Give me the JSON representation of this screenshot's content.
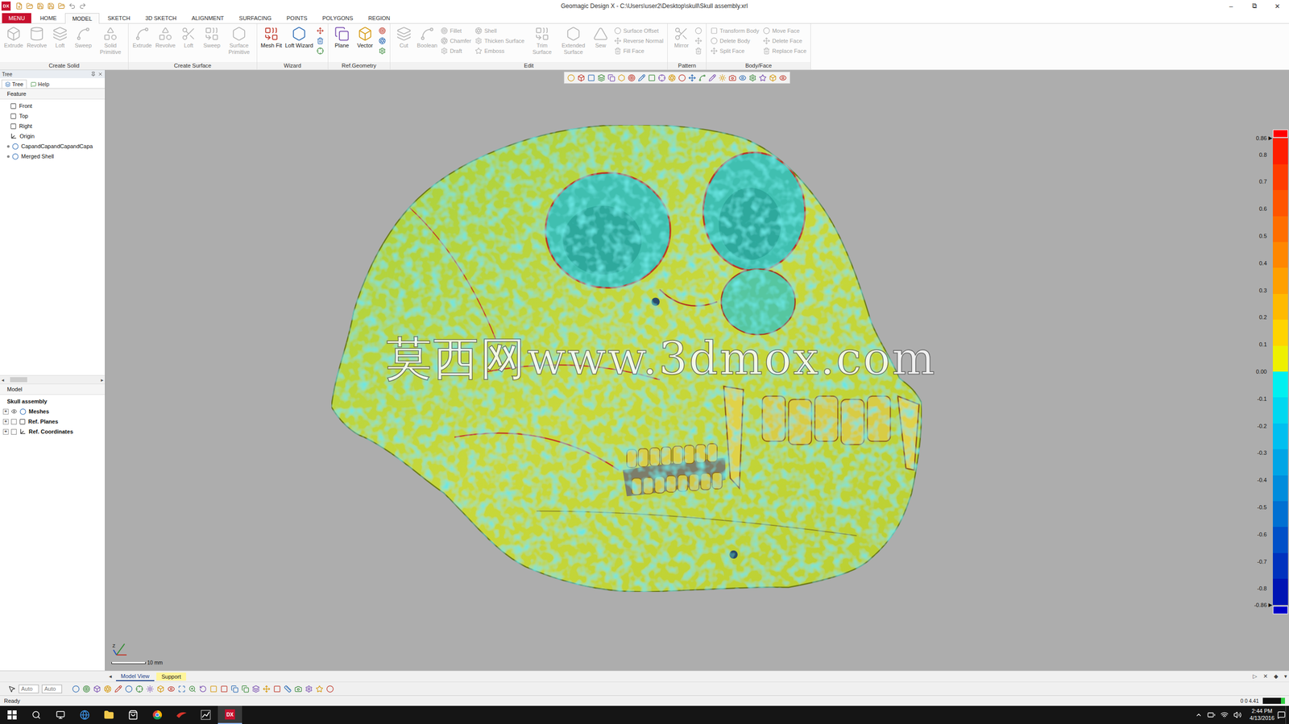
{
  "window": {
    "title": "Geomagic Design X - C:\\Users\\user2\\Desktop\\skull\\Skull assembly.xrl",
    "app_icon": "DX",
    "controls": [
      "–",
      "⧉",
      "✕"
    ]
  },
  "ribbon_tabs": [
    {
      "label": "MENU",
      "selected": false,
      "kind": "menu"
    },
    {
      "label": "HOME",
      "selected": false,
      "kind": "tab"
    },
    {
      "label": "MODEL",
      "selected": true,
      "kind": "tab"
    },
    {
      "label": "SKETCH",
      "selected": false,
      "kind": "tab"
    },
    {
      "label": "3D SKETCH",
      "selected": false,
      "kind": "tab"
    },
    {
      "label": "ALIGNMENT",
      "selected": false,
      "kind": "tab"
    },
    {
      "label": "SURFACING",
      "selected": false,
      "kind": "tab"
    },
    {
      "label": "POINTS",
      "selected": false,
      "kind": "tab"
    },
    {
      "label": "POLYGONS",
      "selected": false,
      "kind": "tab"
    },
    {
      "label": "REGION",
      "selected": false,
      "kind": "tab"
    }
  ],
  "ribbon_groups": [
    {
      "label": "Create Solid",
      "items": [
        {
          "kind": "large",
          "label": "Extrude",
          "disabled": true
        },
        {
          "kind": "large",
          "label": "Revolve",
          "disabled": true
        },
        {
          "kind": "large",
          "label": "Loft",
          "disabled": true
        },
        {
          "kind": "large",
          "label": "Sweep",
          "disabled": true
        },
        {
          "kind": "large",
          "label": "Solid Primitive",
          "disabled": true
        }
      ]
    },
    {
      "label": "Create Surface",
      "items": [
        {
          "kind": "large",
          "label": "Extrude",
          "disabled": true
        },
        {
          "kind": "large",
          "label": "Revolve",
          "disabled": true
        },
        {
          "kind": "large",
          "label": "Loft",
          "disabled": true
        },
        {
          "kind": "large",
          "label": "Sweep",
          "disabled": true
        },
        {
          "kind": "large",
          "label": "Surface Primitive",
          "disabled": true
        }
      ]
    },
    {
      "label": "Wizard",
      "items": [
        {
          "kind": "large",
          "label": "Mesh Fit",
          "disabled": false
        },
        {
          "kind": "large",
          "label": "Loft Wizard",
          "disabled": false
        },
        {
          "kind": "icons",
          "entries": [
            {
              "disabled": false
            },
            {
              "disabled": false
            },
            {
              "disabled": false
            }
          ]
        }
      ]
    },
    {
      "label": "Ref.Geometry",
      "items": [
        {
          "kind": "large",
          "label": "Plane",
          "disabled": false
        },
        {
          "kind": "large",
          "label": "Vector",
          "disabled": false
        },
        {
          "kind": "icons",
          "entries": [
            {
              "disabled": false
            },
            {
              "disabled": false
            },
            {
              "disabled": false
            }
          ]
        }
      ]
    },
    {
      "label": "Edit",
      "items": [
        {
          "kind": "large",
          "label": "Cut",
          "disabled": true
        },
        {
          "kind": "large",
          "label": "Boolean",
          "disabled": true
        },
        {
          "kind": "column",
          "entries": [
            {
              "label": "Fillet",
              "disabled": true
            },
            {
              "label": "Chamfer",
              "disabled": true
            },
            {
              "label": "Draft",
              "disabled": true
            }
          ]
        },
        {
          "kind": "column",
          "entries": [
            {
              "label": "Shell",
              "disabled": true
            },
            {
              "label": "Thicken Surface",
              "disabled": true
            },
            {
              "label": "Emboss",
              "disabled": true
            }
          ]
        },
        {
          "kind": "large",
          "label": "Trim Surface",
          "disabled": true
        },
        {
          "kind": "large",
          "label": "Extended Surface",
          "disabled": true
        },
        {
          "kind": "large",
          "label": "Sew",
          "disabled": true
        },
        {
          "kind": "column",
          "entries": [
            {
              "label": "Surface Offset",
              "disabled": true
            },
            {
              "label": "Reverse Normal",
              "disabled": true
            },
            {
              "label": "Fill Face",
              "disabled": true
            }
          ]
        }
      ]
    },
    {
      "label": "Pattern",
      "items": [
        {
          "kind": "large",
          "label": "Mirror",
          "disabled": true
        },
        {
          "kind": "icons",
          "entries": [
            {
              "disabled": true
            },
            {
              "disabled": true
            },
            {
              "disabled": true
            }
          ]
        }
      ]
    },
    {
      "label": "Body/Face",
      "items": [
        {
          "kind": "column",
          "entries": [
            {
              "label": "Transform Body",
              "disabled": true
            },
            {
              "label": "Delete Body",
              "disabled": true
            },
            {
              "label": "Split Face",
              "disabled": true
            }
          ]
        },
        {
          "kind": "column",
          "entries": [
            {
              "label": "Move Face",
              "disabled": true
            },
            {
              "label": "Delete Face",
              "disabled": true
            },
            {
              "label": "Replace Face",
              "disabled": true
            }
          ]
        }
      ]
    }
  ],
  "left_panel": {
    "title": "Tree",
    "tabs": [
      {
        "label": "Tree",
        "selected": true
      },
      {
        "label": "Help",
        "selected": false
      }
    ],
    "feature_header": "Feature",
    "features": [
      {
        "label": "Front",
        "kind": "plane"
      },
      {
        "label": "Top",
        "kind": "plane"
      },
      {
        "label": "Right",
        "kind": "plane"
      },
      {
        "label": "Origin",
        "kind": "origin"
      },
      {
        "label": "CapandCapandCapandCapa",
        "kind": "body"
      },
      {
        "label": "Merged Shell",
        "kind": "body"
      }
    ],
    "scroll_arrows": [
      "◂",
      "▸"
    ],
    "model_header": "Model",
    "model_items": [
      {
        "label": "Skull assembly",
        "kind": "root",
        "expander": "",
        "visible": true
      },
      {
        "label": "Meshes",
        "kind": "meshes",
        "expander": "+",
        "visible": true
      },
      {
        "label": "Ref. Planes",
        "kind": "planes",
        "expander": "+",
        "visible": false
      },
      {
        "label": "Ref. Coordinates",
        "kind": "coords",
        "expander": "+",
        "visible": false
      }
    ]
  },
  "viewport": {
    "watermark": "莫西网www.3dmox.com",
    "scale": "10 mm",
    "triad_label": "Z"
  },
  "legend": {
    "ticks": [
      "0.86",
      "0.8",
      "0.7",
      "0.6",
      "0.5",
      "0.4",
      "0.3",
      "0.2",
      "0.1",
      "0.00",
      "-0.1",
      "-0.2",
      "-0.3",
      "-0.4",
      "-0.5",
      "-0.6",
      "-0.7",
      "-0.8",
      "-0.86"
    ],
    "marker": "▶",
    "over_color": "#ff0000",
    "under_color": "#0000c8",
    "bands": [
      "#ff1e00",
      "#ff3c00",
      "#ff5500",
      "#ff6e00",
      "#ff8700",
      "#ffa000",
      "#ffba00",
      "#ffd400",
      "#eef000",
      "#00f0f0",
      "#00d8f0",
      "#00bff0",
      "#00a5e6",
      "#008cdc",
      "#0070d2",
      "#0050c8",
      "#0032be",
      "#0014b4"
    ]
  },
  "bottom_tabs": {
    "left": "◂",
    "tabs": [
      {
        "label": "Model View",
        "selected": true,
        "kind": "normal"
      },
      {
        "label": "Support",
        "selected": false,
        "kind": "highlight"
      }
    ],
    "right": [
      "▷",
      "✕",
      "◆",
      "▾"
    ]
  },
  "bottom_toolbar": {
    "selects": [
      "Auto",
      "Auto"
    ]
  },
  "status_bar": {
    "text": "Ready",
    "coords": "0 0 4.41"
  },
  "taskbar": {
    "apps": [
      {
        "kind": "edge",
        "selected": false,
        "label": ""
      },
      {
        "kind": "explorer",
        "selected": false,
        "label": ""
      },
      {
        "kind": "store",
        "selected": false,
        "label": ""
      },
      {
        "kind": "chrome",
        "selected": false,
        "label": ""
      },
      {
        "kind": "app-red",
        "selected": false,
        "label": ""
      },
      {
        "kind": "app-graph",
        "selected": false,
        "label": ""
      },
      {
        "kind": "dx",
        "selected": true,
        "label": "DX"
      }
    ],
    "time": "2:44 PM",
    "date": "4/13/2016"
  }
}
